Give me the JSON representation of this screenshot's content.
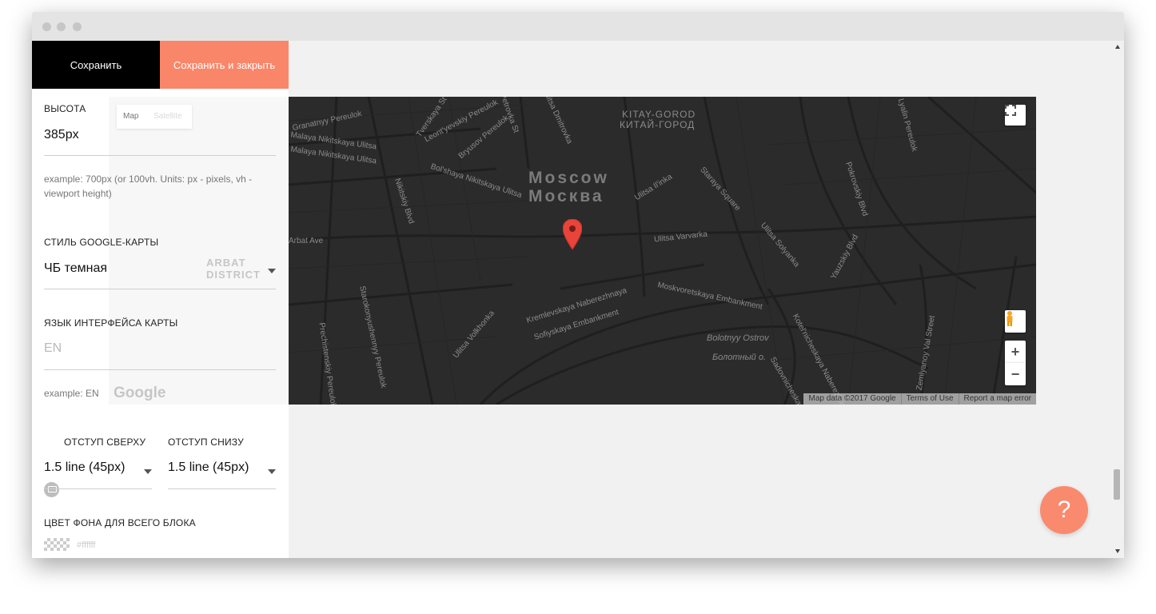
{
  "toolbar": {
    "save_label": "Сохранить",
    "save_close_label": "Сохранить и закрыть"
  },
  "settings": {
    "height": {
      "label": "Высота",
      "value": "385px",
      "hint": "example: 700px (or 100vh. Units: px - pixels, vh - viewport height)"
    },
    "map_style": {
      "label": "Стиль Google-карты",
      "value": "ЧБ темная"
    },
    "map_language": {
      "label": "Язык интерфейса карты",
      "placeholder": "EN",
      "hint": "example: EN"
    },
    "padding_top": {
      "label": "Отступ сверху",
      "value": "1.5 line (45px)"
    },
    "padding_bottom": {
      "label": "Отступ снизу",
      "value": "1.5 line (45px)"
    },
    "background_color": {
      "label": "Цвет фона для всего блока",
      "placeholder": "#ffffff"
    }
  },
  "ghost_map": {
    "tab_map": "Map",
    "tab_satellite": "Satellite",
    "district": "ARBAT DISTRICT",
    "logo": "Google"
  },
  "map": {
    "city_en": "Moscow",
    "city_ru": "Москва",
    "kitay_en": "KITAY-GOROD",
    "kitay_ru": "КИТАЙ-ГОРОД",
    "island_en": "Bolotnyy Ostrov",
    "island_ru": "Болотный о.",
    "streets": [
      "Granatnyy Pereulok",
      "Malaya Nikitskaya Ulitsa",
      "Malaya Nikitskaya Ulitsa",
      "Leont'yevskiy Pereulok",
      "Tverskaya St",
      "Bryusov Pereulok",
      "Bol'shaya Nikitskaya Ulitsa",
      "Nikitskiy Blvd",
      "Arbat Ave",
      "Ulitsa Il'inka",
      "Staraya Square",
      "Ulitsa Varvarka",
      "Ulitsa Solyanka",
      "Pokrovskiy Blvd",
      "Yauzskiy Blvd",
      "Moskvoretskaya Embankment",
      "Kremlevskaya Naberezhnaya",
      "Sofiyskaya Embankment",
      "Ulitsa Volkhonka",
      "Starokonyushennyy Pereulok",
      "Prechistenskiy Pereulok",
      "Kotel'nicheskaya Naberezhnaya",
      "Zemlyanoy Val Street",
      "Lyalin Pereulok",
      "Sadovnicheskaya",
      "Ulitsa Dmitrovka",
      "Petrovka St"
    ],
    "attribution": [
      "Map data ©2017 Google",
      "Terms of Use",
      "Report a map error"
    ],
    "zoom_in": "+",
    "zoom_out": "−",
    "marker_color": "#e8443a"
  },
  "help": {
    "label": "?"
  },
  "colors": {
    "accent": "#fa8669",
    "primary_button": "#000000",
    "map_background": "#2b2b2b"
  }
}
